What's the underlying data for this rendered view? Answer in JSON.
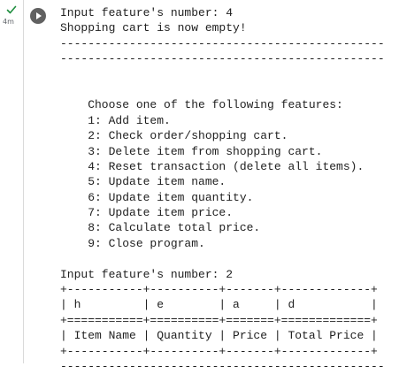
{
  "status": {
    "icon": "check-icon",
    "exec_time": "4m"
  },
  "run_button": {
    "icon": "play-icon"
  },
  "output": {
    "lines": [
      "Input feature's number: 4",
      "Shopping cart is now empty!",
      "-----------------------------------------------",
      "-----------------------------------------------",
      "",
      "",
      "    Choose one of the following features:",
      "    1: Add item.",
      "    2: Check order/shopping cart.",
      "    3: Delete item from shopping cart.",
      "    4: Reset transaction (delete all items).",
      "    5: Update item name.",
      "    6: Update item quantity.",
      "    7: Update item price.",
      "    8: Calculate total price.",
      "    9: Close program.",
      "",
      "Input feature's number: 2",
      "+-----------+----------+-------+-------------+",
      "| h         | e        | a     | d           |",
      "+===========+==========+=======+=============+",
      "| Item Name | Quantity | Price | Total Price |",
      "+-----------+----------+-------+-------------+",
      "-----------------------------------------------"
    ]
  },
  "colors": {
    "success": "#1e8e3e",
    "run_button": "#616161",
    "text": "#212121",
    "muted": "#5f6368"
  }
}
